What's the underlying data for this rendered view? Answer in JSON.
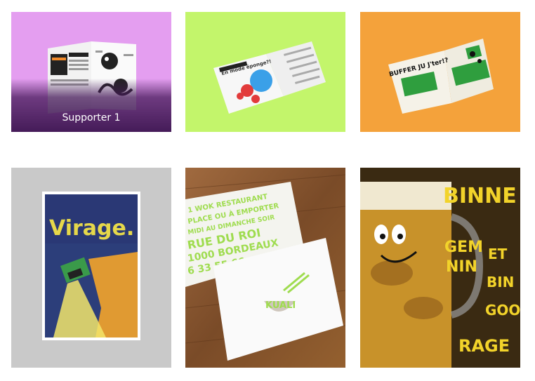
{
  "gallery": {
    "items": [
      {
        "caption": "Supporter 1",
        "bg": "#e49ef0"
      },
      {
        "bg": "#c3f56b"
      },
      {
        "bg": "#f4a23b"
      },
      {
        "bg": "#c9c9c9"
      },
      {
        "bg": "#8a5a35"
      },
      {
        "bg": "#3a2a12"
      }
    ]
  },
  "artwork_text": {
    "magazine2_heading": "En mode éponge?!",
    "magazine3_heading": "BUFFER JU J'ter!?",
    "poster_title": "Virage.",
    "card_lines": [
      "1 WOK RESTAURANT",
      "PLACE OU À EMPORTER",
      "MIDI AU DIMANCHE SOIR",
      "RUE DU ROI",
      "1000 BORDEAUX",
      "6 33 55 66"
    ],
    "card_logo": "KUALI",
    "beer_words": [
      "BINNE",
      "GEM",
      "NIN",
      "ET",
      "BIN",
      "GOO",
      "RAGE"
    ]
  }
}
